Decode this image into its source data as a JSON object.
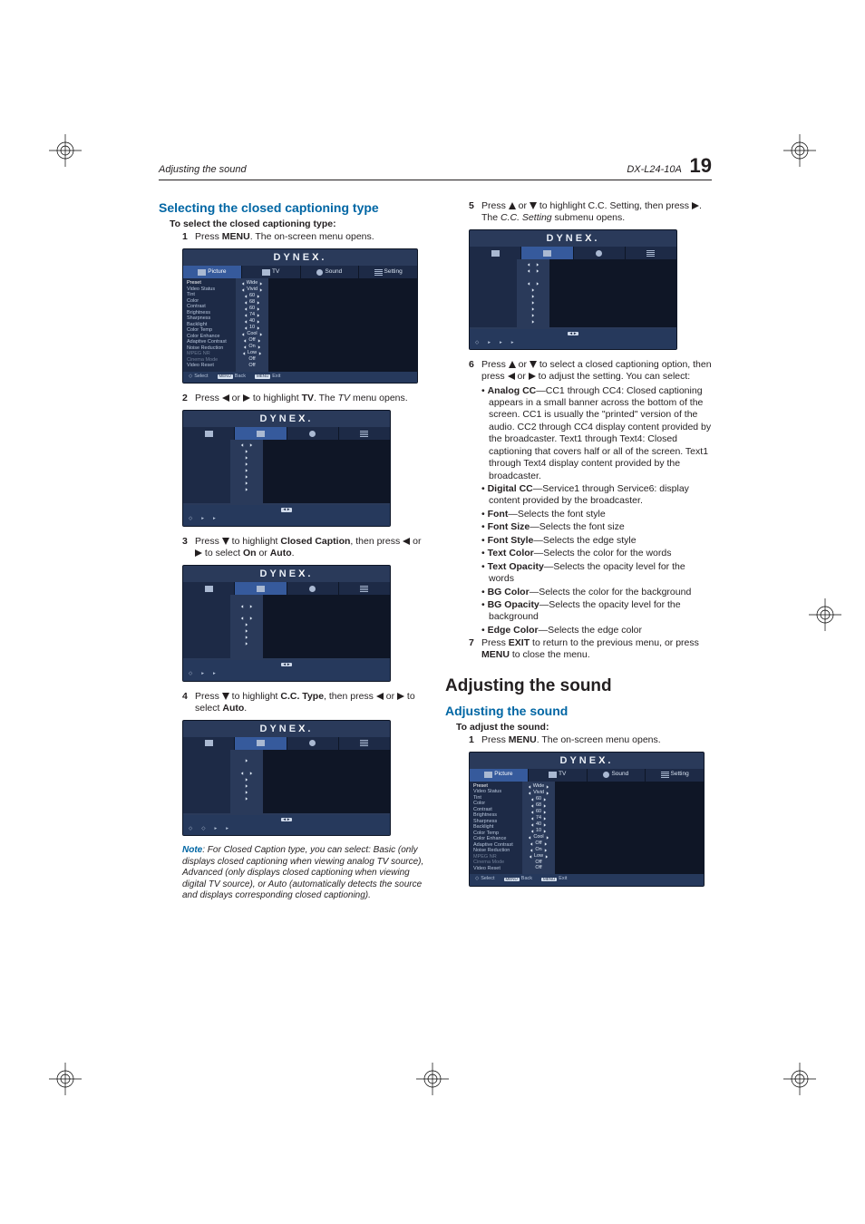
{
  "running_head": {
    "left": "Adjusting the sound",
    "right_model": "DX-L24-10A",
    "page_number": "19"
  },
  "left": {
    "heading": "Selecting the closed captioning type",
    "procedure_title": "To select the closed captioning type:",
    "steps": {
      "s1": {
        "num": "1",
        "a": "Press ",
        "b": "MENU",
        "c": ". The on-screen menu opens."
      },
      "s2": {
        "num": "2",
        "a": "Press ",
        "mid": " or ",
        "b": " to highlight ",
        "c": "TV",
        "d": ". The ",
        "e": "TV",
        "f": " menu opens."
      },
      "s3": {
        "num": "3",
        "a": "Press ",
        "b": " to highlight ",
        "c": "Closed Caption",
        "d": ", then press ",
        "mid": " or ",
        "e": " to select ",
        "f": "On",
        "g": " or ",
        "h": "Auto",
        "i": "."
      },
      "s4": {
        "num": "4",
        "a": "Press ",
        "b": " to highlight ",
        "c": "C.C. Type",
        "d": ", then press ",
        "mid": " or ",
        "e": " to select ",
        "f": "Auto",
        "g": "."
      }
    },
    "note": {
      "label": "Note",
      "body": ": For Closed Caption type, you can select: Basic (only displays closed captioning when viewing analog TV source), Advanced (only displays closed captioning when viewing digital TV source), or Auto (automatically detects the source and displays corresponding closed captioning)."
    }
  },
  "right": {
    "steps": {
      "s5": {
        "num": "5",
        "a": "Press ",
        "mid": " or ",
        "b": " to highlight C.C. Setting, then press ",
        "c": ". The ",
        "d": "C.C. Setting",
        "e": " submenu opens."
      },
      "s6": {
        "num": "6",
        "a": "Press ",
        "mid": " or ",
        "b": " to select a closed captioning option, then press ",
        "mid2": " or ",
        "c": " to adjust the setting. You can select:"
      },
      "s7": {
        "num": "7",
        "a": "Press ",
        "b": "EXIT",
        "c": " to return to the previous menu, or press ",
        "d": "MENU",
        "e": " to close the menu."
      }
    },
    "options": {
      "analog": {
        "name": "Analog CC",
        "desc": "—CC1 through CC4: Closed captioning appears in a small banner across the bottom of the screen. CC1 is usually the \"printed\" version of the audio. CC2 through CC4 display content provided by the broadcaster. Text1 through Text4: Closed captioning that covers half or all of the screen. Text1 through Text4 display content provided by the broadcaster."
      },
      "digital": {
        "name": "Digital CC",
        "desc": "—Service1 through Service6: display content provided by the broadcaster."
      },
      "font": {
        "name": "Font",
        "desc": "—Selects the font style"
      },
      "fontsize": {
        "name": "Font Size",
        "desc": "—Selects the font size"
      },
      "fontstyle": {
        "name": "Font Style",
        "desc": "—Selects the edge style"
      },
      "textcolor": {
        "name": "Text Color",
        "desc": "—Selects the color for the words"
      },
      "textopacity": {
        "name": "Text Opacity",
        "desc": "—Selects the opacity level for the words"
      },
      "bgcolor": {
        "name": "BG Color",
        "desc": "—Selects the color for the background"
      },
      "bgopacity": {
        "name": "BG Opacity",
        "desc": "—Selects the opacity level for the background"
      },
      "edgecolor": {
        "name": "Edge Color",
        "desc": "—Selects the edge color"
      }
    },
    "section_title": "Adjusting the sound",
    "subheading": "Adjusting the sound",
    "procedure_title": "To adjust the sound:",
    "sound_steps": {
      "s1": {
        "num": "1",
        "a": "Press ",
        "b": "MENU",
        "c": ". The on-screen menu opens."
      }
    }
  },
  "osd": {
    "brand": "DYNE",
    "brand_x": "X",
    "brand_dot": ".",
    "tabs": {
      "picture": "Picture",
      "tv": "TV",
      "sound": "Sound",
      "setting": "Setting"
    },
    "picture_menu": {
      "rows": [
        "Preset",
        "Video Status",
        "Tint",
        "Color",
        "Contrast",
        "Brightness",
        "Sharpness",
        "Backlight",
        "Color Temp",
        "Color Enhance",
        "Adaptive Contrast",
        "Noise Reduction",
        "MPEG NR",
        "Cinema Mode",
        "Video Reset"
      ],
      "vals": [
        "Wide",
        "Vivid",
        "60",
        "68",
        "60",
        "74",
        "40",
        "10",
        "Cool",
        "Off",
        "On",
        "Low",
        "Off",
        "Off",
        ""
      ]
    },
    "tv_menu": {
      "rows": [
        "",
        "",
        "",
        "",
        "",
        "",
        "",
        "",
        "",
        ""
      ]
    },
    "foot": {
      "select": "Select",
      "back": "Back",
      "exit": "Exit",
      "menu_cap": "MENU"
    }
  }
}
